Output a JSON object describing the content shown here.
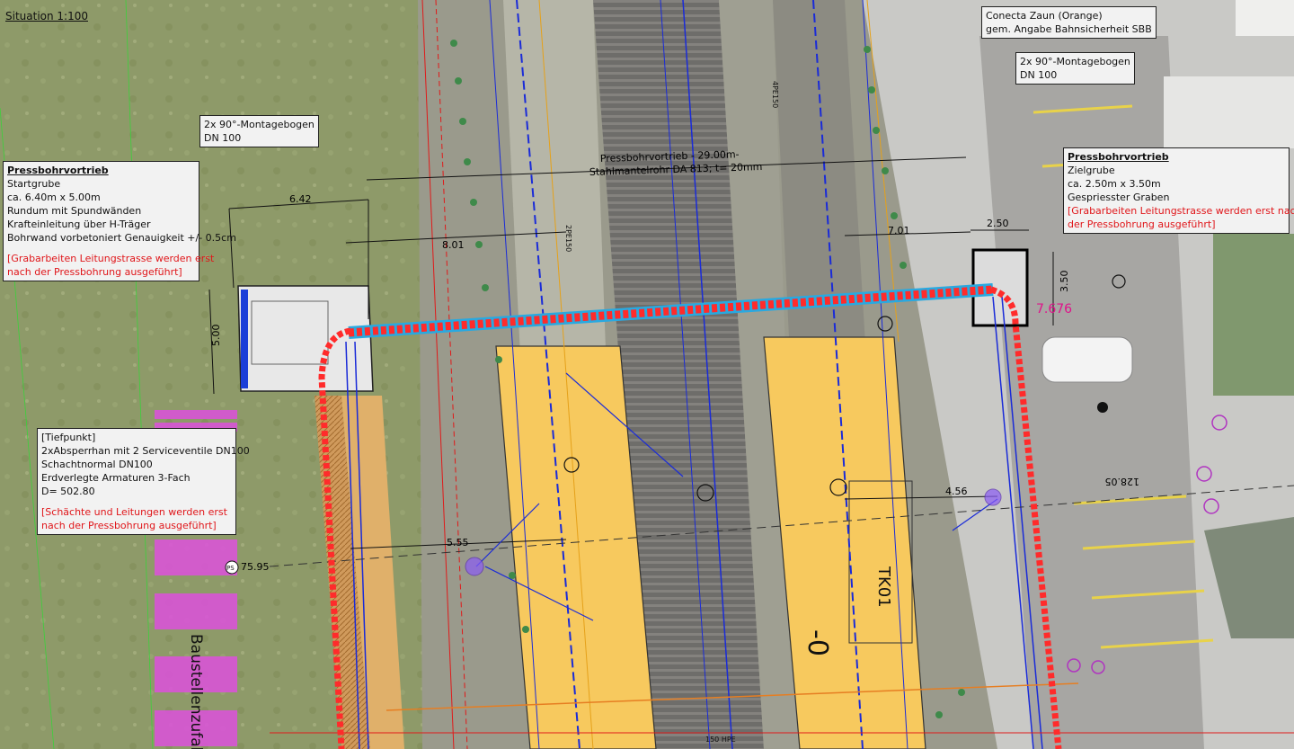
{
  "title": "Situation 1:100",
  "callouts": {
    "montage_left": [
      "2x  90°-Montagebogen",
      "DN 100"
    ],
    "montage_right": [
      "2x 90°-Montagebogen",
      "DN 100"
    ],
    "zaun": [
      "Conecta Zaun (Orange)",
      "gem. Angabe Bahnsicherheit SBB"
    ],
    "startgrube": {
      "title": "Pressbohrvortrieb",
      "lines": [
        "Startgrube",
        "ca. 6.40m x 5.00m",
        "Rundum mit Spundwänden",
        "Krafteinleitung über H-Träger",
        "Bohrwand vorbetoniert Genauigkeit +/- 0.5cm"
      ],
      "note": [
        "[Grabarbeiten Leitungstrasse werden erst",
        "nach der Pressbohrung ausgeführt]"
      ]
    },
    "zielgrube": {
      "title": "Pressbohrvortrieb",
      "lines": [
        "Zielgrube",
        "ca. 2.50m x 3.50m",
        "Gespriesster Graben"
      ],
      "note": [
        "[Grabarbeiten Leitungstrasse werden erst nach",
        "der Pressbohrung ausgeführt]"
      ]
    },
    "tiefpunkt": {
      "lines": [
        "[Tiefpunkt]",
        "2xAbsperrhan mit 2 Serviceventile DN100",
        "Schachtnormal DN100",
        "Erdverlegte Armaturen 3-Fach",
        "D= 502.80"
      ],
      "note": [
        "[Schächte und Leitungen werden erst",
        "nach der Pressbohrung ausgeführt]"
      ]
    }
  },
  "dimensions": {
    "d642": "6.42",
    "d801": "8.01",
    "d500": "5.00",
    "d555": "5.55",
    "d250": "2.50",
    "d350": "3.50",
    "d701": "7.01",
    "d456": "4.56",
    "d7676": "7.676"
  },
  "bore_label": [
    "Pressbohrvortrieb - 29.00m-",
    "Stahlmantelrohr DA 813; t= 20mm"
  ],
  "platform_labels": {
    "tk01": "TK01",
    "zero": "-0"
  },
  "misc_labels": {
    "baustellen": "Baustellenzufahr",
    "ps_station": "75.95",
    "ps": "PS",
    "p128": "128.05",
    "pe150": "2PE150",
    "pe150b": "4PE150",
    "hpe150": "150 HPE"
  },
  "colors": {
    "platform": "#f7c95e",
    "pipe_red": "#ff2b2b",
    "pipe_blue": "#1030d8",
    "grass": "#8f9b6a",
    "asphalt": "#7d7b78",
    "dimension_pink": "#e0118a"
  }
}
